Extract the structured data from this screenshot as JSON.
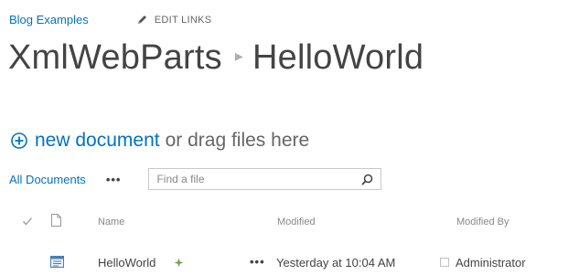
{
  "header": {
    "site_link": "Blog Examples",
    "edit_links": "EDIT LINKS",
    "breadcrumb_parent": "XmlWebParts",
    "breadcrumb_separator": "▸",
    "breadcrumb_current": "HelloWorld"
  },
  "actions": {
    "new_document": "new document",
    "drag_text": "or drag files here"
  },
  "view": {
    "all_documents": "All Documents",
    "more": "•••",
    "search_placeholder": "Find a file"
  },
  "columns": {
    "name": "Name",
    "modified": "Modified",
    "modified_by": "Modified By"
  },
  "rows": [
    {
      "name": "HelloWorld",
      "more": "•••",
      "modified": "Yesterday at 10:04 AM",
      "modified_by": "Administrator"
    }
  ],
  "colors": {
    "link": "#0072c6",
    "text": "#444444",
    "muted": "#888888",
    "new_badge": "#6aa84f"
  },
  "icons": {
    "edit": "pencil-icon",
    "new": "plus-circle-icon",
    "search": "search-icon",
    "select_all": "checkmark-icon",
    "type_header": "document-icon",
    "row_type": "xml-file-icon",
    "new_item": "new-item-badge-icon",
    "presence": "presence-icon"
  }
}
